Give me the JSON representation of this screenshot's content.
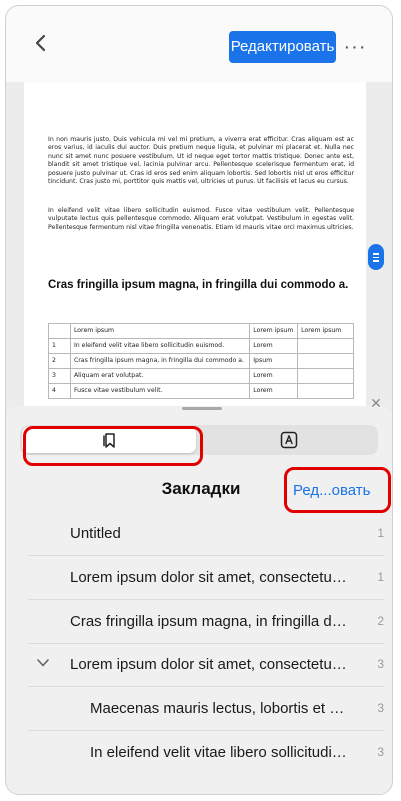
{
  "toolbar": {
    "edit_label": "Редактировать",
    "more_label": "···"
  },
  "document": {
    "paragraph1": "In non mauris justo. Duis vehicula mi vel mi pretium, a viverra erat efficitur. Cras aliquam est ac eros varius, id iaculis dui auctor. Duis pretium neque ligula, et pulvinar mi placerat et. Nulla nec nunc sit amet nunc posuere vestibulum. Ut id neque eget tortor mattis tristique. Donec ante est, blandit sit amet tristique vel, lacinia pulvinar arcu. Pellentesque scelerisque fermentum erat, id posuere justo pulvinar ut. Cras id eros sed enim aliquam lobortis. Sed lobortis nisl ut eros efficitur tincidunt. Cras justo mi, porttitor quis mattis vel, ultricies ut purus. Ut facilisis et lacus eu cursus.",
    "paragraph2": "In eleifend velit vitae libero sollicitudin euismod. Fusce vitae vestibulum velit. Pellentesque vulputate lectus quis pellentesque commodo. Aliquam erat volutpat. Vestibulum in egestas velit. Pellentesque fermentum nisl vitae fringilla venenatis. Etiam id mauris vitae orci maximus ultricies.",
    "heading": "Cras fringilla ipsum magna, in fringilla dui commodo a.",
    "table": {
      "header": [
        "",
        "Lorem ipsum",
        "Lorem ipsum",
        "Lorem ipsum"
      ],
      "rows": [
        [
          "1",
          "In eleifend velit vitae libero sollicitudin euismod.",
          "Lorem",
          ""
        ],
        [
          "2",
          "Cras fringilla ipsum magna, in fringilla dui commodo a.",
          "Ipsum",
          ""
        ],
        [
          "3",
          "Aliquam erat volutpat.",
          "Lorem",
          ""
        ],
        [
          "4",
          "Fusce vitae vestibulum velit.",
          "Lorem",
          ""
        ]
      ]
    }
  },
  "sheet": {
    "title": "Закладки",
    "edit_label": "Ред...овать",
    "close_label": "✕",
    "tabs": [
      {
        "icon": "bookmarks-icon",
        "active": true
      },
      {
        "icon": "annotations-icon",
        "active": false
      }
    ],
    "bookmarks": [
      {
        "title": "Untitled",
        "page": "1",
        "level": 0,
        "expanded": null
      },
      {
        "title": "Lorem ipsum dolor sit amet, consectetur a...",
        "page": "1",
        "level": 0,
        "expanded": null
      },
      {
        "title": "Cras fringilla ipsum magna, in fringilla dui c...",
        "page": "2",
        "level": 0,
        "expanded": null
      },
      {
        "title": "Lorem ipsum dolor sit amet, consectetur a...",
        "page": "3",
        "level": 0,
        "expanded": true
      },
      {
        "title": "Maecenas mauris lectus, lobortis et purus...",
        "page": "3",
        "level": 1,
        "expanded": null
      },
      {
        "title": "In eleifend velit vitae libero sollicitudin e...",
        "page": "3",
        "level": 1,
        "expanded": null
      }
    ]
  },
  "colors": {
    "accent": "#1a73e8",
    "highlight": "#e10000"
  }
}
